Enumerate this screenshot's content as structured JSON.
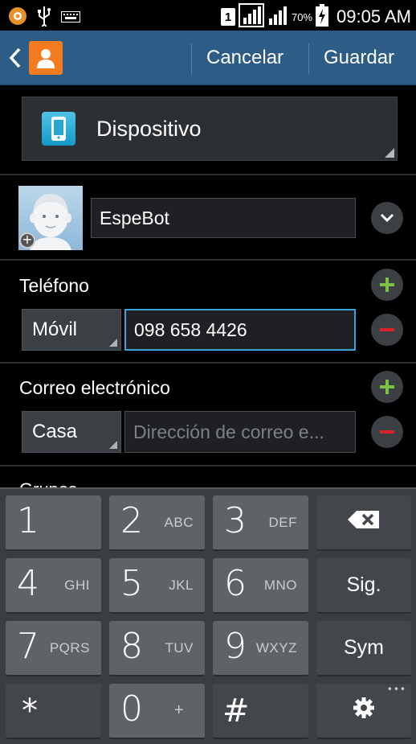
{
  "status_bar": {
    "sim_slot": "1",
    "battery_percent": "70%",
    "time": "09:05 AM"
  },
  "action_bar": {
    "cancel_label": "Cancelar",
    "save_label": "Guardar"
  },
  "storage": {
    "label": "Dispositivo"
  },
  "name_field": {
    "value": "EspeBot"
  },
  "phone_section": {
    "title": "Teléfono",
    "type_label": "Móvil",
    "value": "098 658 4426"
  },
  "email_section": {
    "title": "Correo electrónico",
    "type_label": "Casa",
    "placeholder": "Dirección de correo e..."
  },
  "groups_section": {
    "title": "Grupos"
  },
  "keyboard": {
    "rows": [
      [
        {
          "digit": "1",
          "letters": ""
        },
        {
          "digit": "2",
          "letters": "ABC"
        },
        {
          "digit": "3",
          "letters": "DEF"
        }
      ],
      [
        {
          "digit": "4",
          "letters": "GHI"
        },
        {
          "digit": "5",
          "letters": "JKL"
        },
        {
          "digit": "6",
          "letters": "MNO"
        }
      ],
      [
        {
          "digit": "7",
          "letters": "PQRS"
        },
        {
          "digit": "8",
          "letters": "TUV"
        },
        {
          "digit": "9",
          "letters": "WXYZ"
        }
      ]
    ],
    "star": "*",
    "zero": "0",
    "zero_plus": "+",
    "hash": "#",
    "next_label": "Sig.",
    "sym_label": "Sym",
    "icons": [
      "backspace-icon",
      "settings-gear-icon"
    ]
  }
}
